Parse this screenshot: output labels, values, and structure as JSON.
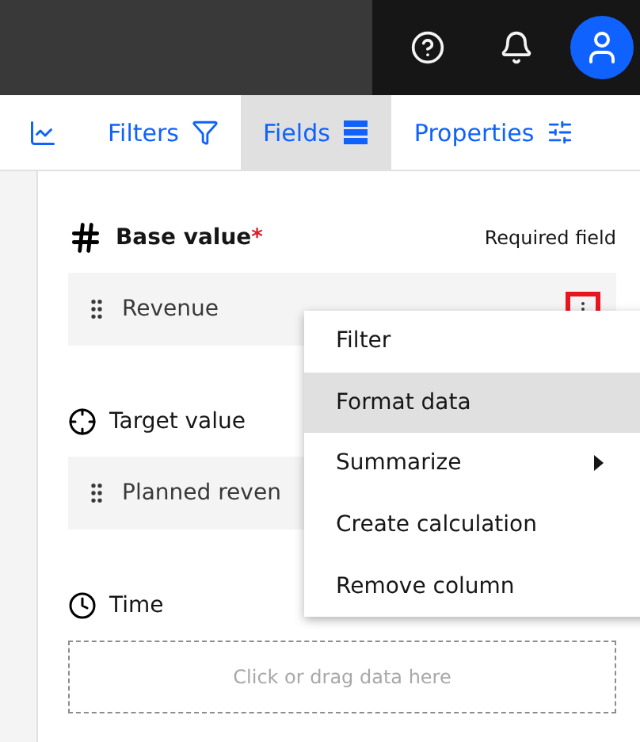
{
  "tabs": [
    {
      "label": "Filters",
      "selected": false
    },
    {
      "label": "Fields",
      "selected": true
    },
    {
      "label": "Properties",
      "selected": false
    }
  ],
  "sections": [
    {
      "label": "Base value",
      "required": true,
      "required_mark": "*",
      "hint": "Required field",
      "field": {
        "kind": "filled",
        "value": "Revenue",
        "highlighted": true
      }
    },
    {
      "label": "Target value",
      "required": false,
      "field": {
        "kind": "filled",
        "value": "Planned reven"
      }
    },
    {
      "label": "Time",
      "required": false,
      "field": {
        "kind": "empty",
        "placeholder": "Click or drag data here"
      }
    }
  ],
  "menu": [
    {
      "label": "Filter",
      "selected": false,
      "submenu": false
    },
    {
      "label": "Format data",
      "selected": true,
      "submenu": false
    },
    {
      "label": "Summarize",
      "selected": false,
      "submenu": true
    },
    {
      "label": "Create calculation",
      "selected": false,
      "submenu": false
    },
    {
      "label": "Remove column",
      "selected": false,
      "submenu": false
    }
  ]
}
